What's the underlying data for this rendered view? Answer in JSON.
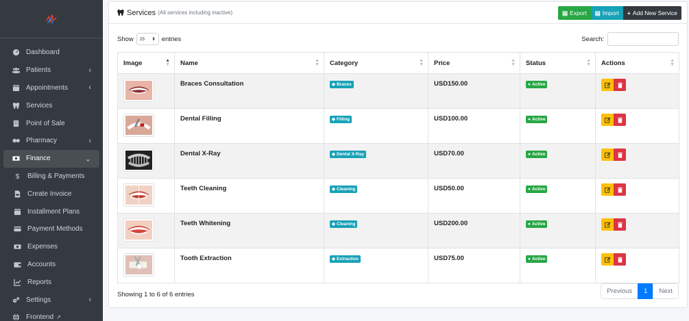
{
  "sidebar": {
    "items": [
      {
        "label": "Dashboard",
        "icon": "gauge-icon",
        "chevron": ""
      },
      {
        "label": "Patients",
        "icon": "users-icon",
        "chevron": "‹"
      },
      {
        "label": "Appointments",
        "icon": "calendar-icon",
        "chevron": "‹"
      },
      {
        "label": "Services",
        "icon": "tooth-icon",
        "chevron": ""
      },
      {
        "label": "Point of Sale",
        "icon": "building-icon",
        "chevron": ""
      },
      {
        "label": "Pharmacy",
        "icon": "pills-icon",
        "chevron": "‹"
      },
      {
        "label": "Finance",
        "icon": "money-icon",
        "chevron": "⌄"
      },
      {
        "label": "Billing & Payments",
        "icon": "dollar-icon",
        "chevron": ""
      },
      {
        "label": "Create Invoice",
        "icon": "file-invoice-icon",
        "chevron": ""
      },
      {
        "label": "Installment Plans",
        "icon": "calendar-icon",
        "chevron": ""
      },
      {
        "label": "Payment Methods",
        "icon": "credit-card-icon",
        "chevron": ""
      },
      {
        "label": "Expenses",
        "icon": "money-bill-icon",
        "chevron": ""
      },
      {
        "label": "Accounts",
        "icon": "wallet-icon",
        "chevron": ""
      },
      {
        "label": "Reports",
        "icon": "chart-icon",
        "chevron": ""
      },
      {
        "label": "Settings",
        "icon": "cogs-icon",
        "chevron": "‹"
      },
      {
        "label": "Frontend",
        "icon": "globe-icon",
        "chevron": ""
      }
    ]
  },
  "card": {
    "title": "Services",
    "subtitle": "(All services including inactive)",
    "export_label": "Export",
    "import_label": "Import",
    "add_label": "Add New Service"
  },
  "toolbar": {
    "show_label": "Show",
    "entries_value": "25",
    "entries_label": "entries",
    "search_label": "Search:",
    "search_value": ""
  },
  "table": {
    "headers": [
      "Image",
      "Name",
      "Category",
      "Price",
      "Status",
      "Actions"
    ],
    "rows": [
      {
        "name": "Braces Consultation",
        "category": "Braces",
        "price": "USD150.00",
        "status": "Active",
        "image": "smile-braces"
      },
      {
        "name": "Dental Filling",
        "category": "Filling",
        "price": "USD100.00",
        "status": "Active",
        "image": "filling"
      },
      {
        "name": "Dental X-Ray",
        "category": "Dental X-Ray",
        "price": "USD70.00",
        "status": "Active",
        "image": "xray"
      },
      {
        "name": "Teeth Cleaning",
        "category": "Cleaning",
        "price": "USD50.00",
        "status": "Active",
        "image": "smile-cleaning"
      },
      {
        "name": "Teeth Whitening",
        "category": "Cleaning",
        "price": "USD200.00",
        "status": "Active",
        "image": "smile-whitening"
      },
      {
        "name": "Tooth Extraction",
        "category": "Extraction",
        "price": "USD75.00",
        "status": "Active",
        "image": "extraction"
      }
    ]
  },
  "footer": {
    "info": "Showing 1 to 6 of 6 entries",
    "previous": "Previous",
    "page": "1",
    "next": "Next"
  },
  "colors": {
    "sidebar_bg": "#343a40",
    "export": "#28a745",
    "import": "#17a2b8",
    "add": "#343a40",
    "badge_info": "#17a2b8",
    "badge_success": "#28a745",
    "edit": "#ffc107",
    "delete": "#dc3545",
    "page_active": "#007bff"
  }
}
